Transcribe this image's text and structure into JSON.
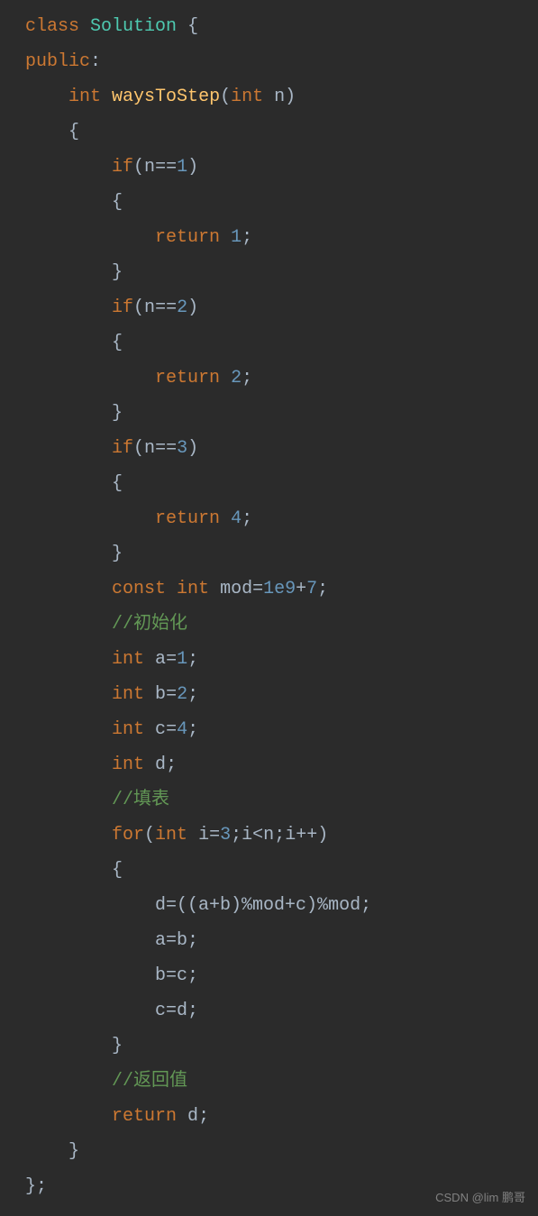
{
  "code": {
    "l1": {
      "class_kw": "class",
      "classname": "Solution",
      "brace": "{"
    },
    "l2": {
      "access": "public",
      "colon": ":"
    },
    "l3": {
      "indent": "    ",
      "type1": "int",
      "funcname": "waysToStep",
      "lparen": "(",
      "type2": "int",
      "param": "n",
      "rparen": ")"
    },
    "l4": {
      "indent": "    ",
      "brace": "{"
    },
    "l5": {
      "indent": "        ",
      "if": "if",
      "cond_open": "(",
      "var": "n",
      "op": "==",
      "num": "1",
      "cond_close": ")"
    },
    "l6": {
      "indent": "        ",
      "brace": "{"
    },
    "l7": {
      "indent": "            ",
      "return": "return",
      "num": "1",
      "semi": ";"
    },
    "l8": {
      "indent": "        ",
      "brace": "}"
    },
    "l9": {
      "indent": "        ",
      "if": "if",
      "cond_open": "(",
      "var": "n",
      "op": "==",
      "num": "2",
      "cond_close": ")"
    },
    "l10": {
      "indent": "        ",
      "brace": "{"
    },
    "l11": {
      "indent": "            ",
      "return": "return",
      "num": "2",
      "semi": ";"
    },
    "l12": {
      "indent": "        ",
      "brace": "}"
    },
    "l13": {
      "indent": "        ",
      "if": "if",
      "cond_open": "(",
      "var": "n",
      "op": "==",
      "num": "3",
      "cond_close": ")"
    },
    "l14": {
      "indent": "        ",
      "brace": "{"
    },
    "l15": {
      "indent": "            ",
      "return": "return",
      "num": "4",
      "semi": ";"
    },
    "l16": {
      "indent": "        ",
      "brace": "}"
    },
    "l17": {
      "indent": "        ",
      "const": "const",
      "type": "int",
      "var": "mod",
      "op": "=",
      "num": "1e9",
      "plus": "+",
      "num2": "7",
      "semi": ";"
    },
    "l18": {
      "indent": "        ",
      "comment": "//初始化"
    },
    "l19": {
      "indent": "        ",
      "type": "int",
      "var": "a",
      "op": "=",
      "num": "1",
      "semi": ";"
    },
    "l20": {
      "indent": "        ",
      "type": "int",
      "var": "b",
      "op": "=",
      "num": "2",
      "semi": ";"
    },
    "l21": {
      "indent": "        ",
      "type": "int",
      "var": "c",
      "op": "=",
      "num": "4",
      "semi": ";"
    },
    "l22": {
      "indent": "        ",
      "type": "int",
      "var": "d",
      "semi": ";"
    },
    "l23": {
      "indent": "        ",
      "comment": "//填表"
    },
    "l24": {
      "indent": "        ",
      "for": "for",
      "lparen": "(",
      "type": "int",
      "var": "i",
      "op": "=",
      "num": "3",
      "semi1": ";",
      "var2": "i",
      "op2": "<",
      "var3": "n",
      "semi2": ";",
      "var4": "i",
      "op3": "++",
      "rparen": ")"
    },
    "l25": {
      "indent": "        ",
      "brace": "{"
    },
    "l26": {
      "indent": "            ",
      "expr": "d=((a+b)%mod+c)%mod;"
    },
    "l27": {
      "indent": "            ",
      "expr": "a=b;"
    },
    "l28": {
      "indent": "            ",
      "expr": "b=c;"
    },
    "l29": {
      "indent": "            ",
      "expr": "c=d;"
    },
    "l30": {
      "indent": "        ",
      "brace": "}"
    },
    "l31": {
      "indent": "        ",
      "comment": "//返回值"
    },
    "l32": {
      "indent": "        ",
      "return": "return",
      "var": "d",
      "semi": ";"
    },
    "l33": {
      "indent": "    ",
      "brace": "}"
    },
    "l34": {
      "brace": "};"
    }
  },
  "watermark": "CSDN @lim 鹏哥"
}
